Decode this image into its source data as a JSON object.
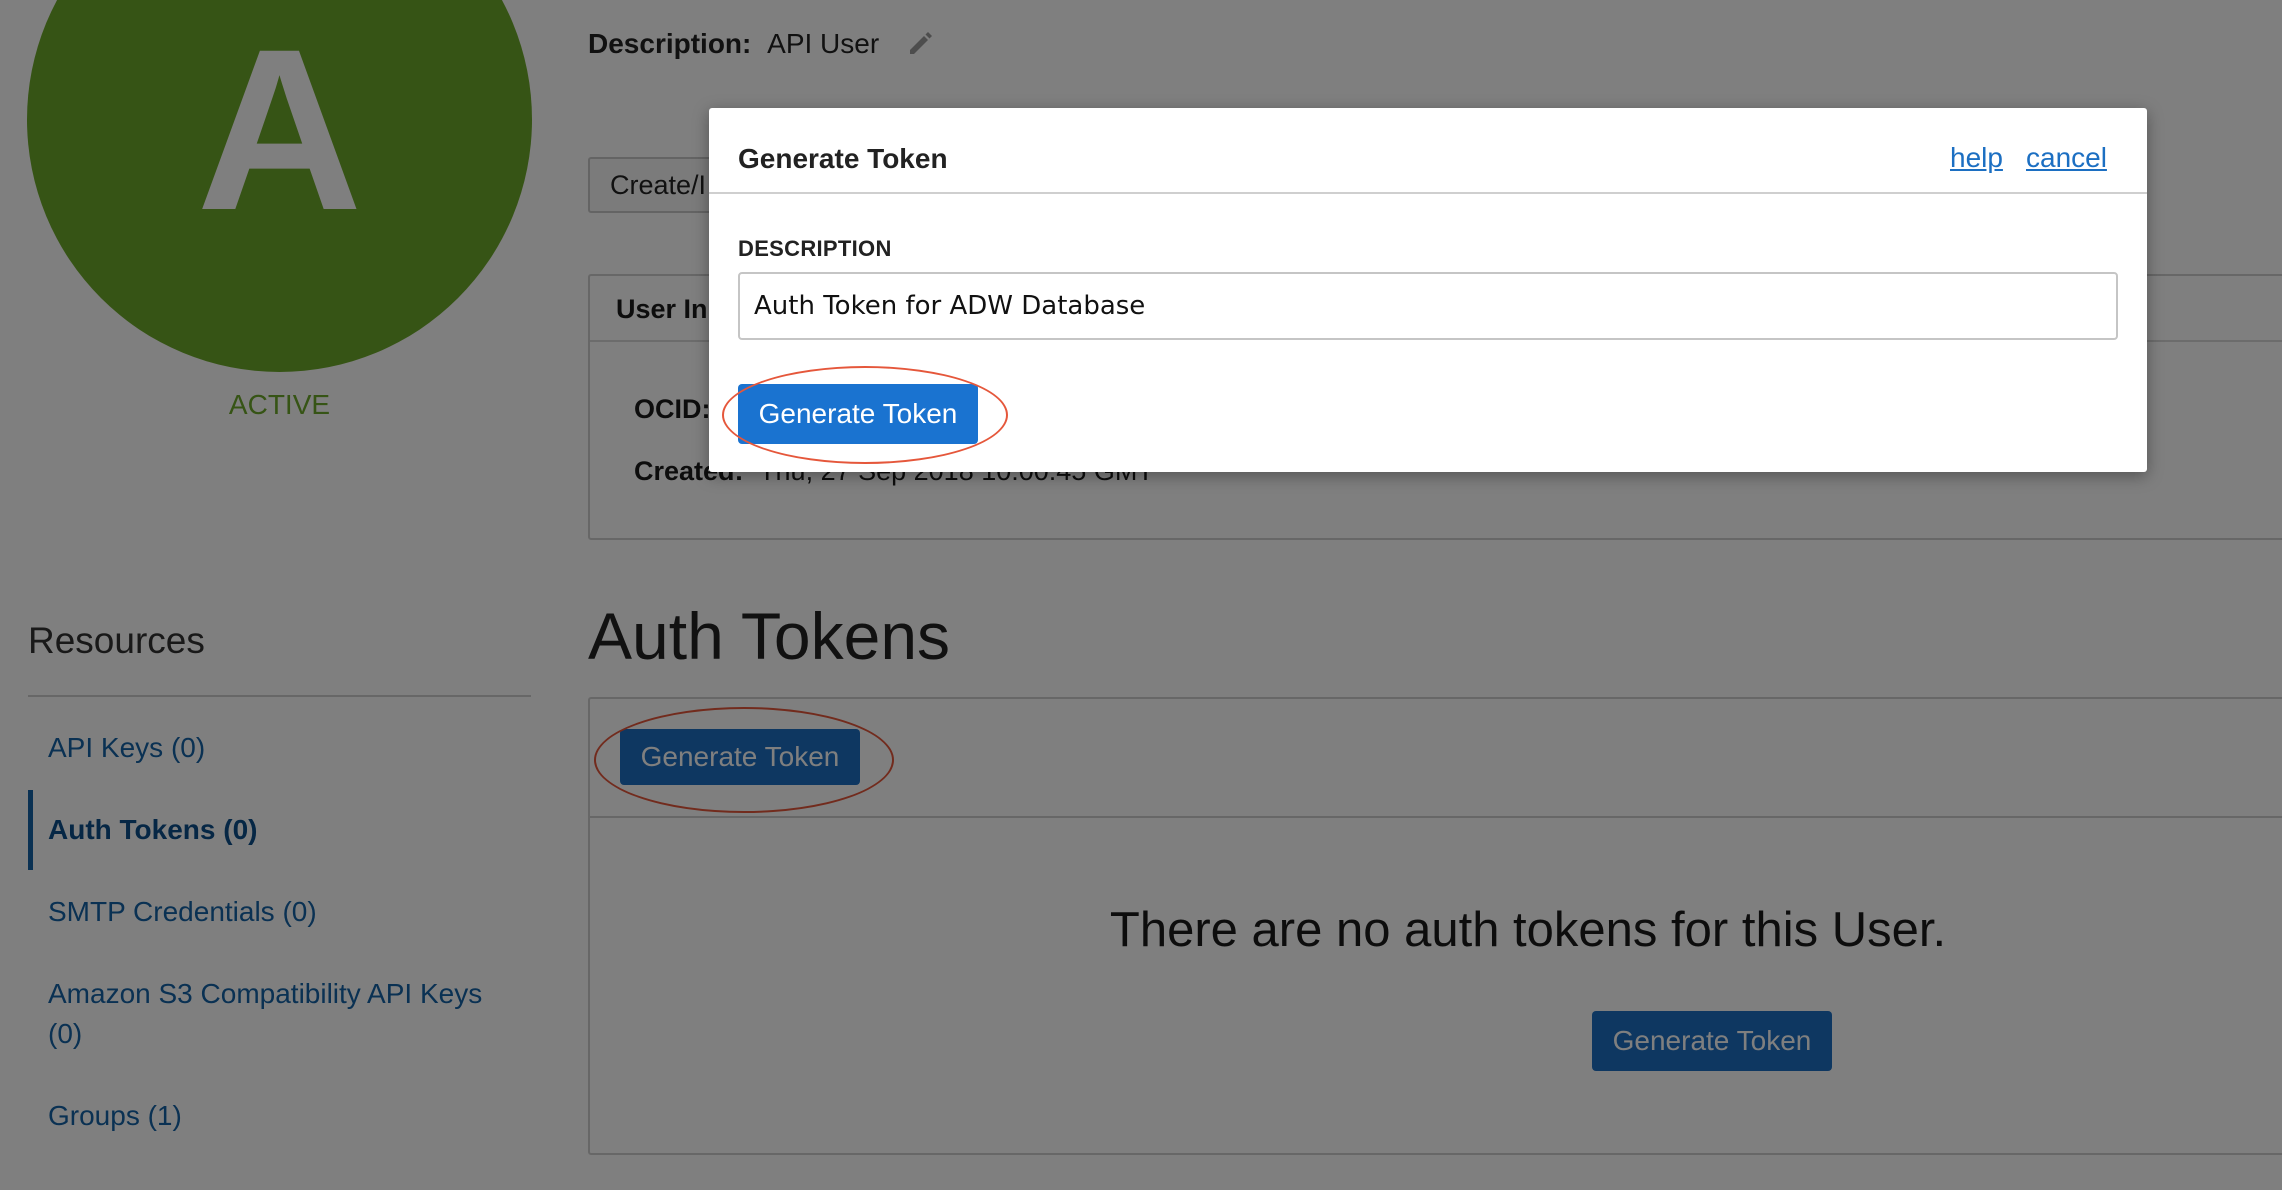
{
  "user": {
    "avatar_letter": "A",
    "status": "ACTIVE",
    "description_label": "Description:",
    "description_value": "API User",
    "create_button_label": "Create/I"
  },
  "user_info": {
    "title": "User In",
    "ocid_label": "OCID:",
    "created_label": "Created:",
    "created_value": "Thu, 27 Sep 2018 10:00:45 GMT"
  },
  "resources": {
    "heading": "Resources",
    "items": [
      {
        "label": "API Keys (0)"
      },
      {
        "label": "Auth Tokens (0)"
      },
      {
        "label": "SMTP Credentials (0)"
      },
      {
        "label": "Amazon S3 Compatibility API Keys (0)"
      },
      {
        "label": "Groups (1)"
      }
    ]
  },
  "auth_tokens": {
    "heading": "Auth Tokens",
    "toolbar_button": "Generate Token",
    "empty_message": "There are no auth tokens for this User.",
    "empty_button": "Generate Token"
  },
  "modal": {
    "title": "Generate Token",
    "help_link": "help",
    "cancel_link": "cancel",
    "field_label": "DESCRIPTION",
    "field_value": "Auth Token for ADW Database",
    "submit_button": "Generate Token"
  },
  "colors": {
    "avatar": "#6da82a",
    "primary_button": "#1c6fc2",
    "link": "#1563a6",
    "callout": "#e5573b"
  },
  "icons": {
    "edit": "pencil-icon"
  }
}
